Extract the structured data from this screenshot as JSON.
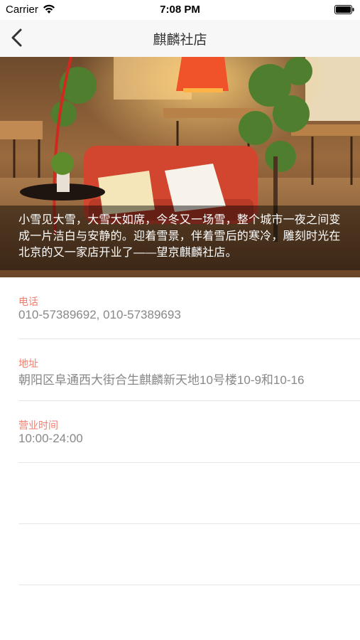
{
  "status_bar": {
    "carrier": "Carrier",
    "time": "7:08 PM",
    "wifi_icon": "wifi-icon",
    "battery_icon": "battery-icon"
  },
  "nav": {
    "title": "麒麟社店",
    "back_icon": "chevron-left-icon"
  },
  "hero": {
    "description": "小雪见大雪，大雪大如席，今冬又一场雪，整个城市一夜之间变成一片洁白与安静的。迎着雪景，伴着雪后的寒冷，雕刻时光在北京的又一家店开业了——望京麒麟社店。"
  },
  "info": [
    {
      "label": "电话",
      "value": "010-57389692, 010-57389693"
    },
    {
      "label": "地址",
      "value": "朝阳区阜通西大街合生麒麟新天地10号楼10-9和10-16"
    },
    {
      "label": "营业时间",
      "value": "10:00-24:00"
    }
  ],
  "colors": {
    "label_accent": "#f07e6e",
    "value_text": "#888888",
    "nav_background": "#f7f7f7"
  }
}
